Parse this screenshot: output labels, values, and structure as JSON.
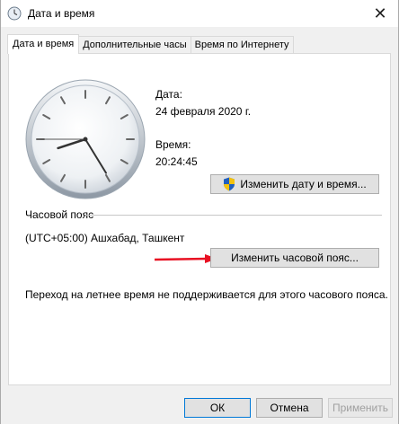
{
  "window": {
    "title": "Дата и время",
    "close_glyph": "✕"
  },
  "tabs": [
    {
      "label": "Дата и время",
      "active": true
    },
    {
      "label": "Дополнительные часы",
      "active": false
    },
    {
      "label": "Время по Интернету",
      "active": false
    }
  ],
  "date_time": {
    "date_label": "Дата:",
    "date_value": "24 февраля 2020 г.",
    "time_label": "Время:",
    "time_value": "20:24:45",
    "change_datetime_button": "Изменить дату и время..."
  },
  "timezone": {
    "section_label": "Часовой пояс",
    "value": "(UTC+05:00) Ашхабад, Ташкент",
    "change_timezone_button": "Изменить часовой пояс..."
  },
  "dst_note": "Переход на летнее время не поддерживается для этого часового пояса.",
  "footer": {
    "ok_label": "ОК",
    "cancel_label": "Отмена",
    "apply_label": "Применить"
  },
  "colors": {
    "annotation_arrow": "#e81123",
    "accent": "#0078d7"
  },
  "icons": {
    "app": "clock-icon",
    "uac": "uac-shield-icon"
  }
}
